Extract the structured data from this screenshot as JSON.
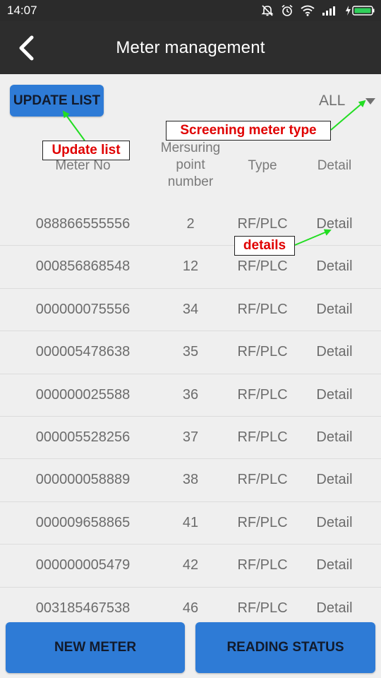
{
  "status_bar": {
    "time": "14:07",
    "icons": [
      "mute-icon",
      "alarm-icon",
      "wifi-icon",
      "signal-icon",
      "battery-charging-icon"
    ]
  },
  "app_bar": {
    "back_icon": "back-chevron-icon",
    "title": "Meter management"
  },
  "toolbar": {
    "update_button": "UPDATE LIST",
    "filter_value": "ALL",
    "filter_icon": "dropdown-triangle-icon"
  },
  "table": {
    "headers": {
      "meter_no": "Meter No",
      "point_line1": "Mersuring",
      "point_line2": "point",
      "point_line3": "number",
      "type": "Type",
      "detail": "Detail"
    },
    "rows": [
      {
        "meter_no": "088866555556",
        "point": "2",
        "type": "RF/PLC",
        "detail": "Detail"
      },
      {
        "meter_no": "000856868548",
        "point": "12",
        "type": "RF/PLC",
        "detail": "Detail"
      },
      {
        "meter_no": "000000075556",
        "point": "34",
        "type": "RF/PLC",
        "detail": "Detail"
      },
      {
        "meter_no": "000005478638",
        "point": "35",
        "type": "RF/PLC",
        "detail": "Detail"
      },
      {
        "meter_no": "000000025588",
        "point": "36",
        "type": "RF/PLC",
        "detail": "Detail"
      },
      {
        "meter_no": "000005528256",
        "point": "37",
        "type": "RF/PLC",
        "detail": "Detail"
      },
      {
        "meter_no": "000000058889",
        "point": "38",
        "type": "RF/PLC",
        "detail": "Detail"
      },
      {
        "meter_no": "000009658865",
        "point": "41",
        "type": "RF/PLC",
        "detail": "Detail"
      },
      {
        "meter_no": "000000005479",
        "point": "42",
        "type": "RF/PLC",
        "detail": "Detail"
      },
      {
        "meter_no": "003185467538",
        "point": "46",
        "type": "RF/PLC",
        "detail": "Detail"
      }
    ]
  },
  "bottom_buttons": {
    "new_meter": "NEW METER",
    "reading_status": "READING STATUS"
  },
  "annotations": {
    "update_list": "Update list",
    "screening": "Screening meter type",
    "details": "details"
  },
  "colors": {
    "accent": "#2e7bd6",
    "app_bar": "#2d2d2d",
    "background": "#efefef",
    "annotation_text": "#e00000",
    "arrow": "#22dd22"
  }
}
